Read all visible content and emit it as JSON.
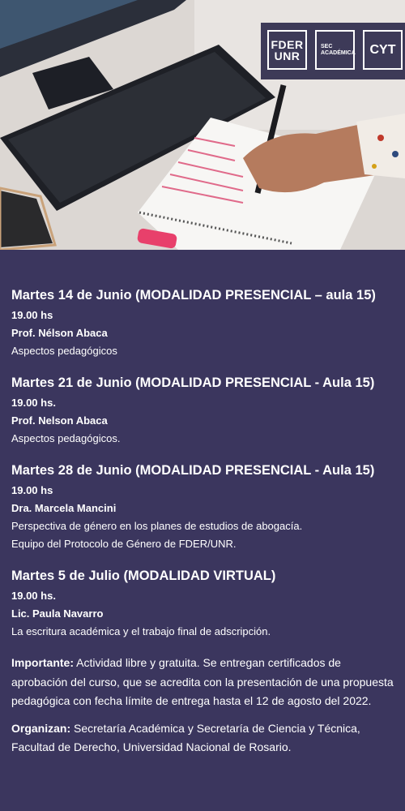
{
  "logos": {
    "fder_line1": "FDER",
    "fder_line2": "UNR",
    "sec_line1": "SEC",
    "sec_line2": "ACADÉMICA",
    "cyt": "CYT"
  },
  "sessions": [
    {
      "title": "Martes 14 de Junio (MODALIDAD PRESENCIAL – aula 15)",
      "time": "19.00 hs",
      "teacher": "Prof. Nélson Abaca",
      "topic": "Aspectos pedagógicos",
      "extra": ""
    },
    {
      "title": "Martes 21 de Junio (MODALIDAD PRESENCIAL - Aula 15)",
      "time": "19.00 hs.",
      "teacher": "Prof. Nelson Abaca",
      "topic": "Aspectos pedagógicos.",
      "extra": ""
    },
    {
      "title": "Martes 28 de Junio (MODALIDAD PRESENCIAL - Aula 15)",
      "time": "19.00 hs",
      "teacher": "Dra. Marcela Mancini",
      "topic": "Perspectiva de género en los planes de estudios de abogacía.",
      "extra": "Equipo del Protocolo de Género de FDER/UNR."
    },
    {
      "title": "Martes 5 de Julio (MODALIDAD VIRTUAL)",
      "time": "19.00 hs.",
      "teacher": "Lic. Paula Navarro",
      "topic": "La escritura académica y el trabajo final de adscripción.",
      "extra": ""
    }
  ],
  "importante": {
    "label": "Importante:",
    "text": " Actividad libre y gratuita. Se entregan certificados de aprobación del curso, que se acredita con la presentación de una propuesta pedagógica con fecha límite de entrega hasta el 12 de agosto del 2022."
  },
  "organizan": {
    "label": "Organizan:",
    "text": " Secretaría Académica y Secretaría de Ciencia y Técnica, Facultad de Derecho, Universidad Nacional de Rosario."
  }
}
